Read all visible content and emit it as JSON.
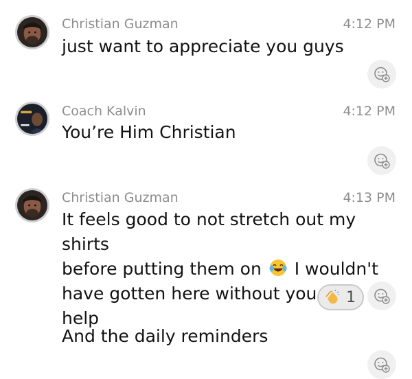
{
  "messages": [
    {
      "author": "Christian Guzman",
      "time": "4:12 PM",
      "text": "just want to appreciate you guys"
    },
    {
      "author": "Coach Kalvin",
      "time": "4:12 PM",
      "text": "You’re Him Christian"
    },
    {
      "author": "Christian Guzman",
      "time": "4:13 PM",
      "text_line1": "It feels good to not stretch out my shirts",
      "text_line2a": "before putting them on",
      "text_line2_emoji": "face-with-tears-of-joy",
      "text_line2b": "I wouldn't",
      "text_line3": "have gotten here without you guys help",
      "reaction": {
        "emoji": "clapping-hands",
        "count": "1"
      }
    },
    {
      "text": "And the daily reminders"
    }
  ],
  "icons": {
    "add_reaction": "add-reaction-icon"
  },
  "colors": {
    "meta_gray": "#8d8d8d",
    "text": "#121212",
    "button_bg": "#f0f0f0"
  }
}
